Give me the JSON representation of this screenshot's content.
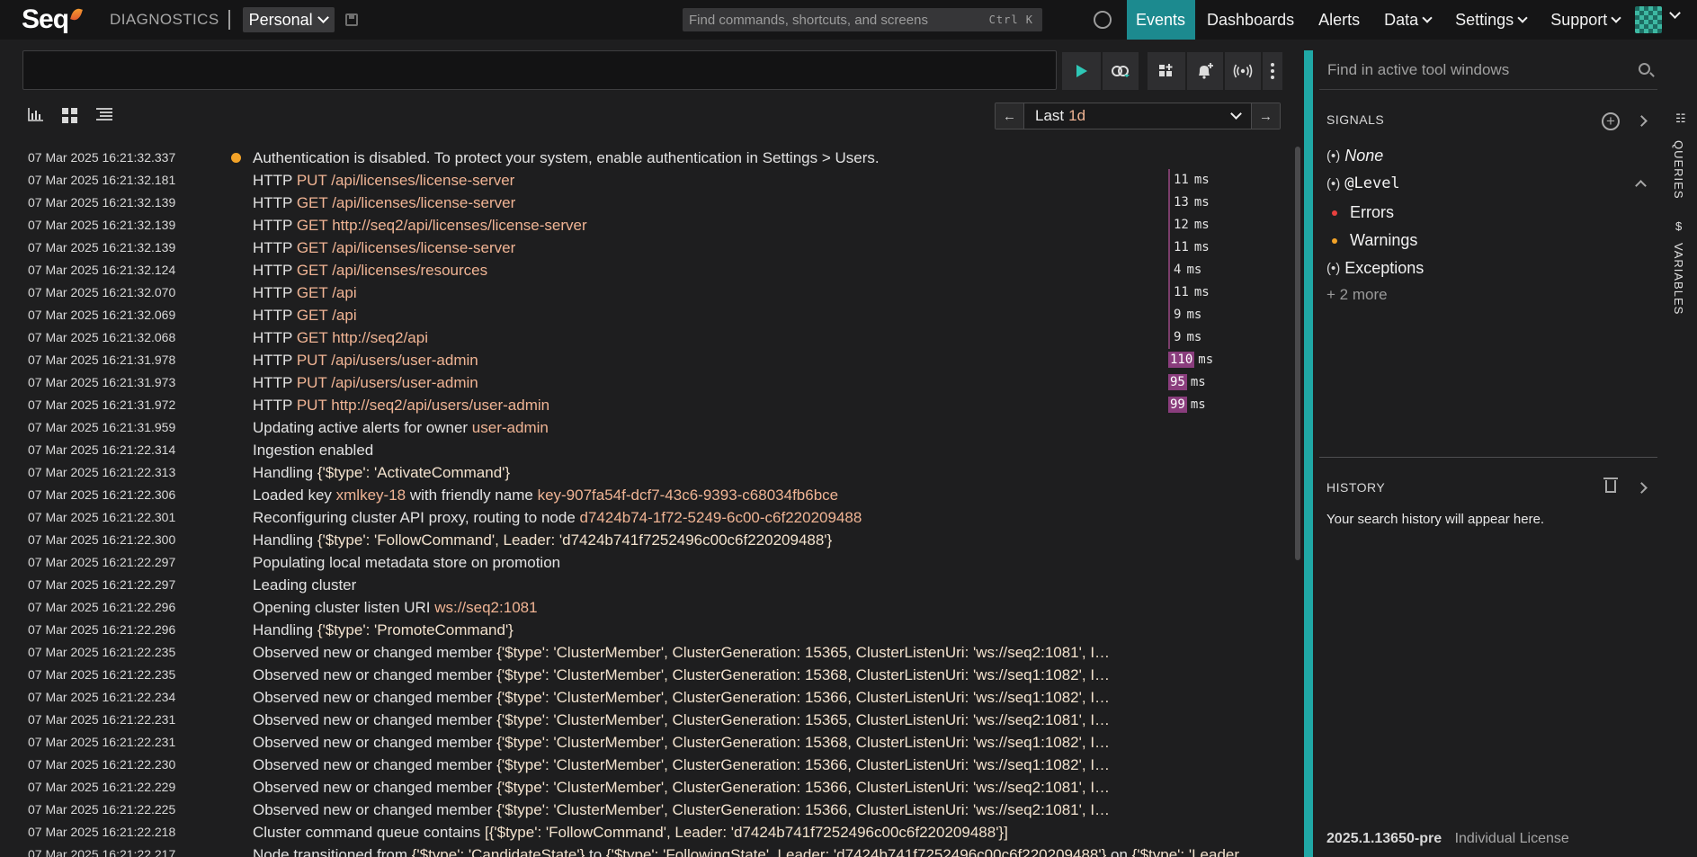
{
  "app": {
    "logo_text": "Seq",
    "context_label": "DIAGNOSTICS",
    "workspace": "Personal",
    "command_search": {
      "placeholder": "Find commands, shortcuts, and screens",
      "shortcut": "Ctrl K"
    },
    "nav": [
      "Events",
      "Dashboards",
      "Alerts",
      "Data",
      "Settings",
      "Support"
    ],
    "nav_active": "Events"
  },
  "query": {
    "value": "",
    "buttons": [
      "run-query",
      "refresh",
      "add-to-dashboard",
      "add-alert",
      "signal",
      "more"
    ]
  },
  "time_range": {
    "prefix": "Last",
    "value": "1d"
  },
  "view_modes": [
    "chart-view",
    "grid-view",
    "list-view"
  ],
  "events": [
    {
      "ts": "07 Mar 2025  16:21:32.337",
      "level": "warning",
      "parts": [
        {
          "t": "Authentication is disabled. To protect your system, enable authentication in Settings > Users."
        }
      ]
    },
    {
      "ts": "07 Mar 2025  16:21:32.181",
      "parts": [
        {
          "t": "HTTP "
        },
        {
          "t": "PUT",
          "c": "hl"
        },
        {
          "t": " "
        },
        {
          "t": "/api/licenses/license-server",
          "c": "hl"
        }
      ],
      "elapsed": "11",
      "unit": "ms"
    },
    {
      "ts": "07 Mar 2025  16:21:32.139",
      "parts": [
        {
          "t": "HTTP "
        },
        {
          "t": "GET",
          "c": "hl"
        },
        {
          "t": " "
        },
        {
          "t": "/api/licenses/license-server",
          "c": "hl"
        }
      ],
      "elapsed": "13",
      "unit": "ms"
    },
    {
      "ts": "07 Mar 2025  16:21:32.139",
      "parts": [
        {
          "t": "HTTP "
        },
        {
          "t": "GET",
          "c": "hl"
        },
        {
          "t": " "
        },
        {
          "t": "http://seq2/api/licenses/license-server",
          "c": "hl"
        }
      ],
      "elapsed": "12",
      "unit": "ms"
    },
    {
      "ts": "07 Mar 2025  16:21:32.139",
      "parts": [
        {
          "t": "HTTP "
        },
        {
          "t": "GET",
          "c": "hl"
        },
        {
          "t": " "
        },
        {
          "t": "/api/licenses/license-server",
          "c": "hl"
        }
      ],
      "elapsed": "11",
      "unit": "ms"
    },
    {
      "ts": "07 Mar 2025  16:21:32.124",
      "parts": [
        {
          "t": "HTTP "
        },
        {
          "t": "GET",
          "c": "hl"
        },
        {
          "t": " "
        },
        {
          "t": "/api/licenses/resources",
          "c": "hl"
        }
      ],
      "elapsed": "4",
      "unit": "ms"
    },
    {
      "ts": "07 Mar 2025  16:21:32.070",
      "parts": [
        {
          "t": "HTTP "
        },
        {
          "t": "GET",
          "c": "hl"
        },
        {
          "t": " "
        },
        {
          "t": "/api",
          "c": "hl"
        }
      ],
      "elapsed": "11",
      "unit": "ms"
    },
    {
      "ts": "07 Mar 2025  16:21:32.069",
      "parts": [
        {
          "t": "HTTP "
        },
        {
          "t": "GET",
          "c": "hl"
        },
        {
          "t": " "
        },
        {
          "t": "/api",
          "c": "hl"
        }
      ],
      "elapsed": "9",
      "unit": "ms"
    },
    {
      "ts": "07 Mar 2025  16:21:32.068",
      "parts": [
        {
          "t": "HTTP "
        },
        {
          "t": "GET",
          "c": "hl"
        },
        {
          "t": " "
        },
        {
          "t": "http://seq2/api",
          "c": "hl"
        }
      ],
      "elapsed": "9",
      "unit": "ms"
    },
    {
      "ts": "07 Mar 2025  16:21:31.978",
      "parts": [
        {
          "t": "HTTP "
        },
        {
          "t": "PUT",
          "c": "hl"
        },
        {
          "t": " "
        },
        {
          "t": "/api/users/user-admin",
          "c": "hl"
        }
      ],
      "elapsed": "110",
      "unit": "ms",
      "slow": true
    },
    {
      "ts": "07 Mar 2025  16:21:31.973",
      "parts": [
        {
          "t": "HTTP "
        },
        {
          "t": "PUT",
          "c": "hl"
        },
        {
          "t": " "
        },
        {
          "t": "/api/users/user-admin",
          "c": "hl"
        }
      ],
      "elapsed": "95",
      "unit": "ms",
      "slow": true
    },
    {
      "ts": "07 Mar 2025  16:21:31.972",
      "parts": [
        {
          "t": "HTTP "
        },
        {
          "t": "PUT",
          "c": "hl"
        },
        {
          "t": " "
        },
        {
          "t": "http://seq2/api/users/user-admin",
          "c": "hl"
        }
      ],
      "elapsed": "99",
      "unit": "ms",
      "slow": true
    },
    {
      "ts": "07 Mar 2025  16:21:31.959",
      "parts": [
        {
          "t": "Updating active alerts for owner "
        },
        {
          "t": "user-admin",
          "c": "hl"
        }
      ]
    },
    {
      "ts": "07 Mar 2025  16:21:22.314",
      "parts": [
        {
          "t": "Ingestion enabled"
        }
      ]
    },
    {
      "ts": "07 Mar 2025  16:21:22.313",
      "parts": [
        {
          "t": "Handling "
        },
        {
          "t": "{'$type': 'ActivateCommand'}",
          "c": "obj"
        }
      ]
    },
    {
      "ts": "07 Mar 2025  16:21:22.306",
      "parts": [
        {
          "t": "Loaded key "
        },
        {
          "t": "xmlkey-18",
          "c": "hl"
        },
        {
          "t": " with friendly name "
        },
        {
          "t": "key-907fa54f-dcf7-43c6-9393-c68034fb6bce",
          "c": "hl"
        }
      ]
    },
    {
      "ts": "07 Mar 2025  16:21:22.301",
      "parts": [
        {
          "t": "Reconfiguring cluster API proxy, routing to node "
        },
        {
          "t": "d7424b74-1f72-5249-6c00-c6f220209488",
          "c": "hl"
        }
      ]
    },
    {
      "ts": "07 Mar 2025  16:21:22.300",
      "parts": [
        {
          "t": "Handling "
        },
        {
          "t": "{'$type': 'FollowCommand', Leader: 'd7424b741f7252496c00c6f220209488'}",
          "c": "obj"
        }
      ]
    },
    {
      "ts": "07 Mar 2025  16:21:22.297",
      "parts": [
        {
          "t": "Populating local metadata store on promotion"
        }
      ]
    },
    {
      "ts": "07 Mar 2025  16:21:22.297",
      "parts": [
        {
          "t": "Leading cluster"
        }
      ]
    },
    {
      "ts": "07 Mar 2025  16:21:22.296",
      "parts": [
        {
          "t": "Opening cluster listen URI "
        },
        {
          "t": "ws://seq2:1081",
          "c": "hl"
        }
      ]
    },
    {
      "ts": "07 Mar 2025  16:21:22.296",
      "parts": [
        {
          "t": "Handling "
        },
        {
          "t": "{'$type': 'PromoteCommand'}",
          "c": "obj"
        }
      ]
    },
    {
      "ts": "07 Mar 2025  16:21:22.235",
      "trunc": true,
      "parts": [
        {
          "t": "Observed new or changed member "
        },
        {
          "t": "{'$type': 'ClusterMember', ClusterGeneration: 15365, ClusterListenUri: 'ws://seq2:1081', I…",
          "c": "obj"
        }
      ]
    },
    {
      "ts": "07 Mar 2025  16:21:22.235",
      "trunc": true,
      "parts": [
        {
          "t": "Observed new or changed member "
        },
        {
          "t": "{'$type': 'ClusterMember', ClusterGeneration: 15368, ClusterListenUri: 'ws://seq1:1082', I…",
          "c": "obj"
        }
      ]
    },
    {
      "ts": "07 Mar 2025  16:21:22.234",
      "trunc": true,
      "parts": [
        {
          "t": "Observed new or changed member "
        },
        {
          "t": "{'$type': 'ClusterMember', ClusterGeneration: 15366, ClusterListenUri: 'ws://seq1:1082', I…",
          "c": "obj"
        }
      ]
    },
    {
      "ts": "07 Mar 2025  16:21:22.231",
      "trunc": true,
      "parts": [
        {
          "t": "Observed new or changed member "
        },
        {
          "t": "{'$type': 'ClusterMember', ClusterGeneration: 15365, ClusterListenUri: 'ws://seq2:1081', I…",
          "c": "obj"
        }
      ]
    },
    {
      "ts": "07 Mar 2025  16:21:22.231",
      "trunc": true,
      "parts": [
        {
          "t": "Observed new or changed member "
        },
        {
          "t": "{'$type': 'ClusterMember', ClusterGeneration: 15368, ClusterListenUri: 'ws://seq1:1082', I…",
          "c": "obj"
        }
      ]
    },
    {
      "ts": "07 Mar 2025  16:21:22.230",
      "trunc": true,
      "parts": [
        {
          "t": "Observed new or changed member "
        },
        {
          "t": "{'$type': 'ClusterMember', ClusterGeneration: 15366, ClusterListenUri: 'ws://seq1:1082', I…",
          "c": "obj"
        }
      ]
    },
    {
      "ts": "07 Mar 2025  16:21:22.229",
      "trunc": true,
      "parts": [
        {
          "t": "Observed new or changed member "
        },
        {
          "t": "{'$type': 'ClusterMember', ClusterGeneration: 15366, ClusterListenUri: 'ws://seq2:1081', I…",
          "c": "obj"
        }
      ]
    },
    {
      "ts": "07 Mar 2025  16:21:22.225",
      "trunc": true,
      "parts": [
        {
          "t": "Observed new or changed member "
        },
        {
          "t": "{'$type': 'ClusterMember', ClusterGeneration: 15366, ClusterListenUri: 'ws://seq2:1081', I…",
          "c": "obj"
        }
      ]
    },
    {
      "ts": "07 Mar 2025  16:21:22.218",
      "parts": [
        {
          "t": "Cluster command queue contains "
        },
        {
          "t": "[{'$type': 'FollowCommand', Leader: 'd7424b741f7252496c00c6f220209488'}]",
          "c": "obj"
        }
      ]
    },
    {
      "ts": "07 Mar 2025  16:21:22.217",
      "parts": [
        {
          "t": "Node transitioned from "
        },
        {
          "t": "{'$type': 'CandidateState'}",
          "c": "obj"
        },
        {
          "t": " to "
        },
        {
          "t": "{'$type': 'FollowingState', Leader: 'd7424b741f7252496c00c6f220209488'}",
          "c": "obj"
        },
        {
          "t": " on "
        },
        {
          "t": "{'$type': 'Leader",
          "c": "obj"
        }
      ]
    }
  ],
  "sidebar": {
    "search_placeholder": "Find in active tool windows",
    "signals_title": "SIGNALS",
    "signals": {
      "none_label": "None",
      "level_label": "@Level",
      "level_items": [
        {
          "label": "Errors",
          "color": "#e8403e"
        },
        {
          "label": "Warnings",
          "color": "#f3a328"
        }
      ],
      "exceptions_label": "Exceptions",
      "more_label": "+ 2 more"
    },
    "history_title": "HISTORY",
    "history_empty": "Your search history will appear here.",
    "version": "2025.1.13650-pre",
    "license": "Individual License"
  },
  "vertical_tabs": [
    "QUERIES",
    "VARIABLES"
  ],
  "colors": {
    "accent": "#1c8a8f",
    "panel_accent": "#20a8a6",
    "highlight": "#f0b494",
    "slow": "#8a3d7d"
  }
}
